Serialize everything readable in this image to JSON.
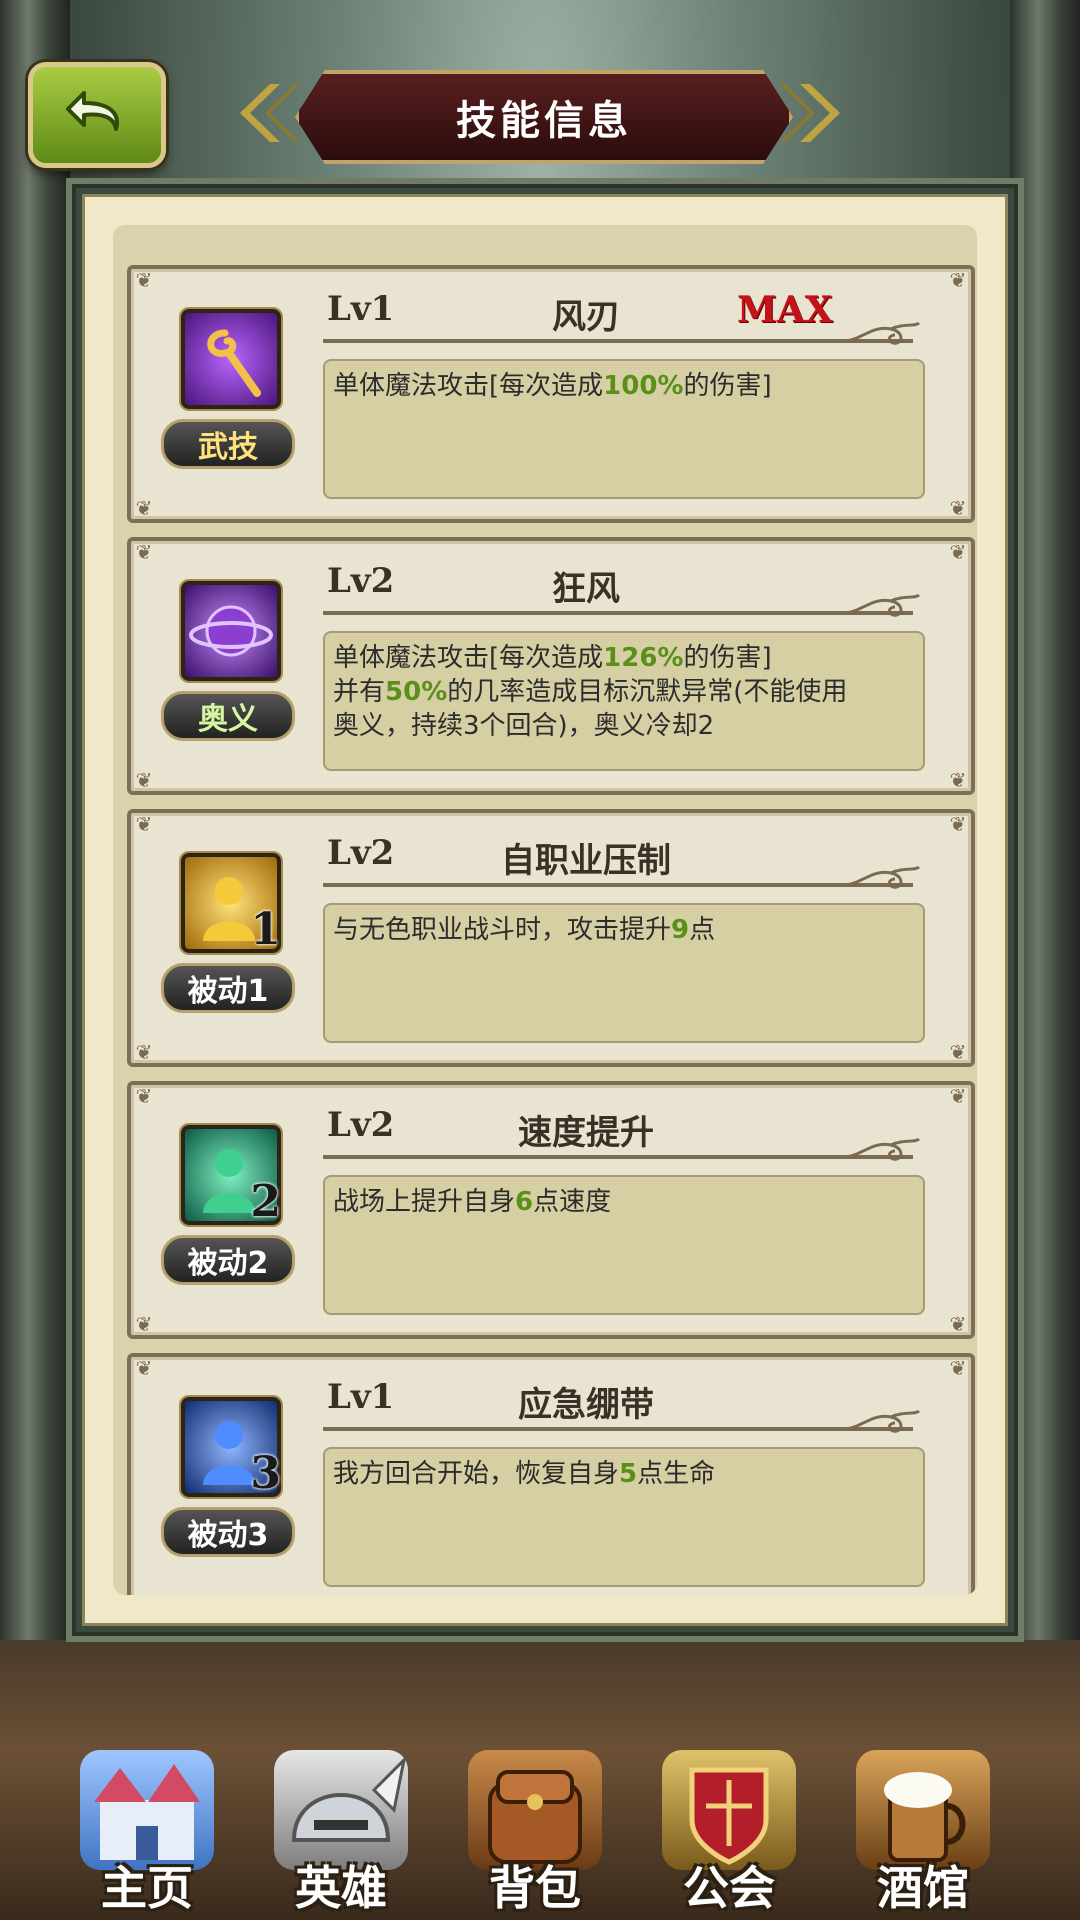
{
  "header": {
    "title": "技能信息"
  },
  "skills": [
    {
      "level": "Lv1",
      "name": "风刃",
      "max": "MAX",
      "type": "武技",
      "desc": [
        {
          "t": "单体魔法攻击[每次造成"
        },
        {
          "t": "100%",
          "hl": true
        },
        {
          "t": "的伤害]"
        }
      ]
    },
    {
      "level": "Lv2",
      "name": "狂风",
      "max": "",
      "type": "奥义",
      "desc": [
        {
          "t": "单体魔法攻击[每次造成"
        },
        {
          "t": "126%",
          "hl": true
        },
        {
          "t": "的伤害]\n并有"
        },
        {
          "t": "50%",
          "hl": true
        },
        {
          "t": "的几率造成目标沉默异常(不能使用\n奥义，持续3个回合)，奥义冷却2"
        }
      ]
    },
    {
      "level": "Lv2",
      "name": "自职业压制",
      "max": "",
      "type": "被动1",
      "badge_num": "1",
      "desc": [
        {
          "t": "与无色职业战斗时，攻击提升"
        },
        {
          "t": "9",
          "hl": true
        },
        {
          "t": "点"
        }
      ]
    },
    {
      "level": "Lv2",
      "name": "速度提升",
      "max": "",
      "type": "被动2",
      "badge_num": "2",
      "desc": [
        {
          "t": "战场上提升自身"
        },
        {
          "t": "6",
          "hl": true
        },
        {
          "t": "点速度"
        }
      ]
    },
    {
      "level": "Lv1",
      "name": "应急绷带",
      "max": "",
      "type": "被动3",
      "badge_num": "3",
      "desc": [
        {
          "t": "我方回合开始，恢复自身"
        },
        {
          "t": "5",
          "hl": true
        },
        {
          "t": "点生命"
        }
      ]
    }
  ],
  "nav": [
    {
      "label": "主页"
    },
    {
      "label": "英雄"
    },
    {
      "label": "背包"
    },
    {
      "label": "公会"
    },
    {
      "label": "酒馆"
    }
  ],
  "colors": {
    "highlight": "#5a8f19",
    "max": "#c8121a"
  }
}
